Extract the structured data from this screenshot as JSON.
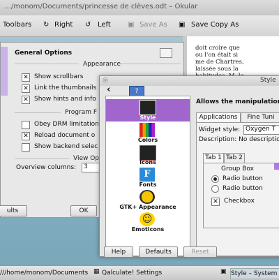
{
  "okular": {
    "title": "…/monom/Documents/princesse de clèves.odt – Okular",
    "toolbar": {
      "toolbars": "Toolbars",
      "right": "Right",
      "left": "Left",
      "save_as": "Save As",
      "save_copy_as": "Save Copy As"
    },
    "document_text": "doit croire que\nou l'on était si\nme de Chartres,\nlaissée sous la\nhabitudes. M. le"
  },
  "general_options": {
    "header": "General Options",
    "appearance_section": "Appearance",
    "show_scrollbars": "Show scrollbars",
    "link_thumbnails": "Link the thumbnails",
    "show_hints": "Show hints and info",
    "program_features_section": "Program F",
    "obey_drm": "Obey DRM limitation",
    "reload_document": "Reload document o",
    "show_backend": "Show backend selec",
    "view_options_section": "View Op",
    "overview_columns_label": "Overview columns:",
    "overview_columns_value": "3",
    "defaults_button": "ults",
    "ok_button": "OK"
  },
  "style_dialog": {
    "title": "Style",
    "heading": "Allows the manipulation o",
    "categories": [
      "Style",
      "Colors",
      "Icons",
      "Fonts",
      "GTK+ Appearance",
      "Emoticons"
    ],
    "tabs": [
      "Applications",
      "Fine Tuni"
    ],
    "widget_style_label": "Widget style:",
    "widget_style_value": "Oxygen T",
    "description": "Description: No descriptio",
    "preview_tabs": [
      "Tab 1",
      "Tab 2"
    ],
    "group_box_label": "Group Box",
    "radio_button_1": "Radio button",
    "radio_button_2": "Radio button",
    "checkbox_label": "Checkbox",
    "help_button": "Help",
    "defaults_button": "Defaults",
    "reset_button": "Reset"
  },
  "taskbar": {
    "items": [
      "///home/monom/Documents",
      "Qalculate! Settings",
      "Style – System"
    ]
  }
}
